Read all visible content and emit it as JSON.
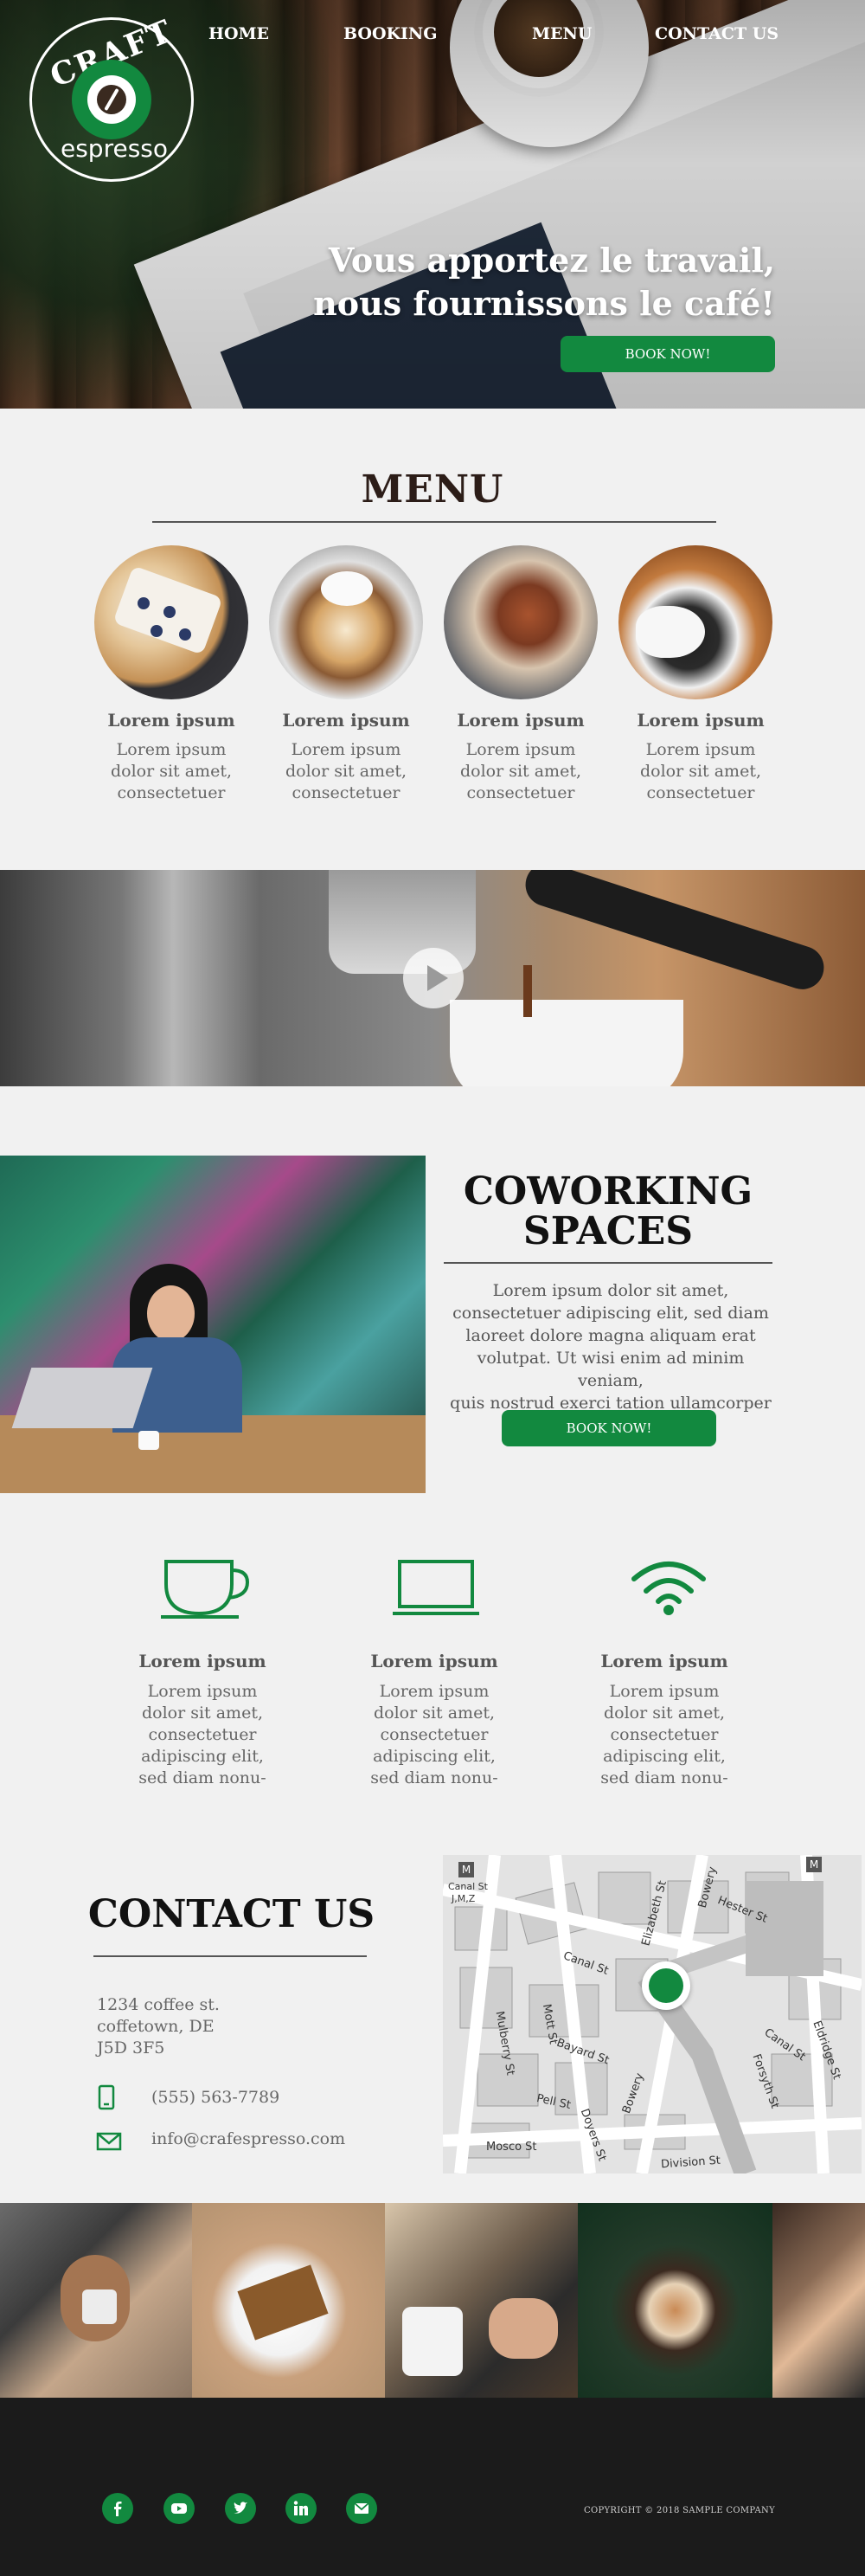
{
  "colors": {
    "accent": "#12893f",
    "footer_bg": "#1b1b1b",
    "page_bg": "#f1f1f1"
  },
  "logo": {
    "word_top": "CRAFT",
    "word_bottom": "espresso"
  },
  "nav": {
    "home": "HOME",
    "booking": "BOOKING",
    "menu": "MENU",
    "contact": "CONTACT US"
  },
  "hero": {
    "title_line1": "Vous apportez le travail,",
    "title_line2": "nous fournissons le café!",
    "cta": "BOOK NOW!"
  },
  "menu": {
    "title": "MENU",
    "items": [
      {
        "name": "Lorem ipsum",
        "desc1": "Lorem ipsum",
        "desc2": "dolor sit amet,",
        "desc3": "consectetuer"
      },
      {
        "name": "Lorem ipsum",
        "desc1": "Lorem ipsum",
        "desc2": "dolor sit amet,",
        "desc3": "consectetuer"
      },
      {
        "name": "Lorem ipsum",
        "desc1": "Lorem ipsum",
        "desc2": "dolor sit amet,",
        "desc3": "consectetuer"
      },
      {
        "name": "Lorem ipsum",
        "desc1": "Lorem ipsum",
        "desc2": "dolor sit amet,",
        "desc3": "consectetuer"
      }
    ]
  },
  "coworking": {
    "title_line1": "COWORKING",
    "title_line2": "SPACES",
    "text1": "Lorem ipsum dolor sit amet,",
    "text2": "consectetuer adipiscing elit, sed diam",
    "text3": "laoreet dolore magna aliquam erat",
    "text4": "volutpat. Ut wisi enim ad minim veniam,",
    "text5": "quis nostrud exerci tation ullamcorper",
    "cta": "BOOK NOW!"
  },
  "features": [
    {
      "icon": "coffee-cup-icon",
      "name": "Lorem ipsum",
      "l1": "Lorem ipsum",
      "l2": "dolor sit amet,",
      "l3": "consectetuer",
      "l4": "adipiscing elit,",
      "l5": "sed diam nonu-"
    },
    {
      "icon": "laptop-icon",
      "name": "Lorem ipsum",
      "l1": "Lorem ipsum",
      "l2": "dolor sit amet,",
      "l3": "consectetuer",
      "l4": "adipiscing elit,",
      "l5": "sed diam nonu-"
    },
    {
      "icon": "wifi-icon",
      "name": "Lorem ipsum",
      "l1": "Lorem ipsum",
      "l2": "dolor sit amet,",
      "l3": "consectetuer",
      "l4": "adipiscing elit,",
      "l5": "sed diam nonu-"
    }
  ],
  "contact": {
    "title": "CONTACT US",
    "address1": "1234 coffee st.",
    "address2": "coffetown, DE",
    "address3": "J5D 3F5",
    "phone": "(555) 563-7789",
    "email": "info@crafespresso.com"
  },
  "map": {
    "streets": [
      "Canal St",
      "Hester St",
      "Elizabeth St",
      "Bowery",
      "Mott St",
      "Mulberry St",
      "Bayard St",
      "Pell St",
      "Mosco St",
      "Doyers St",
      "Division St",
      "Canal St",
      "Eldridge St",
      "Forsyth St",
      "Canal St"
    ],
    "markers": [
      "M",
      "M"
    ],
    "legend": "J,M,Z"
  },
  "footer": {
    "social": [
      "facebook-icon",
      "youtube-icon",
      "twitter-icon",
      "linkedin-icon",
      "email-icon"
    ],
    "copyright": "COPYRIGHT © 2018 SAMPLE COMPANY"
  }
}
